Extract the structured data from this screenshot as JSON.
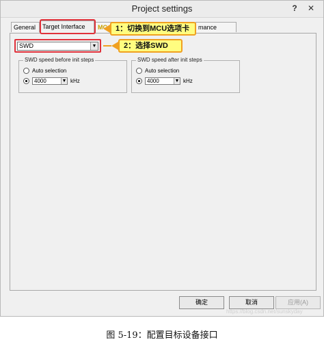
{
  "window": {
    "title": "Project settings",
    "help_label": "?",
    "close_label": "✕"
  },
  "tabs": [
    {
      "label": "General"
    },
    {
      "label": "Target Interface"
    },
    {
      "label": "MC"
    },
    {
      "label": "mance"
    }
  ],
  "callouts": {
    "first": "1：切换到MCU选项卡",
    "second": "2：选择SWD"
  },
  "interface_select": {
    "value": "SWD"
  },
  "speed_before": {
    "legend": "SWD speed before init steps",
    "auto_label": "Auto selection",
    "speed_value": "4000",
    "unit": "kHz"
  },
  "speed_after": {
    "legend": "SWD speed after init steps",
    "auto_label": "Auto selection",
    "speed_value": "4000",
    "unit": "kHz"
  },
  "buttons": {
    "ok": "确定",
    "cancel": "取消",
    "apply": "应用(A)"
  },
  "watermark": "https://blog.csdn.net/sunskyday",
  "caption": "图 5-19：配置目标设备接口",
  "colors": {
    "highlight_red": "#e0313a",
    "callout_yellow": "#fffd80",
    "callout_border": "#f0a020"
  }
}
